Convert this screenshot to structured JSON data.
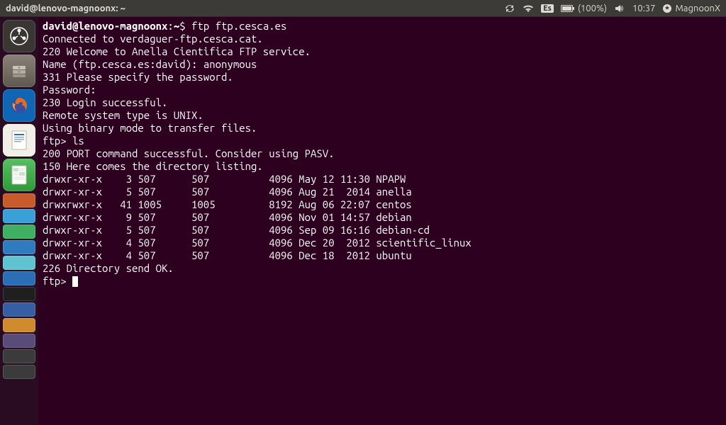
{
  "menubar": {
    "title": "david@lenovo-magnoonx: ~",
    "lang": "Es",
    "battery": "(100%)",
    "time": "10:37",
    "user": "MagnoonX"
  },
  "terminal": {
    "prompt_user": "david@lenovo-magnoonx",
    "prompt_path": "~",
    "cmd1": "ftp ftp.cesca.es",
    "l1": "Connected to verdaguer-ftp.cesca.cat.",
    "l2": "220 Welcome to Anella Cientifica FTP service.",
    "l3a": "Name (ftp.cesca.es:david): ",
    "l3b": "anonymous",
    "l4": "331 Please specify the password.",
    "l5": "Password:",
    "l6": "230 Login successful.",
    "l7": "Remote system type is UNIX.",
    "l8": "Using binary mode to transfer files.",
    "ftp_prompt": "ftp> ",
    "cmd2": "ls",
    "l9": "200 PORT command successful. Consider using PASV.",
    "l10": "150 Here comes the directory listing.",
    "rows": [
      "drwxr-xr-x    3 507      507          4096 May 12 11:30 NPAPW",
      "drwxr-xr-x    5 507      507          4096 Aug 21  2014 anella",
      "drwxrwxr-x   41 1005     1005         8192 Aug 06 22:07 centos",
      "drwxr-xr-x    9 507      507          4096 Nov 01 14:57 debian",
      "drwxr-xr-x    5 507      507          4096 Sep 09 16:16 debian-cd",
      "drwxr-xr-x    4 507      507          4096 Dec 20  2012 scientific_linux",
      "drwxr-xr-x    4 507      507          4096 Dec 18  2012 ubuntu"
    ],
    "l11": "226 Directory send OK."
  },
  "launcher": {
    "tiles": [
      {
        "name": "dash",
        "bg": "#3a3633"
      },
      {
        "name": "files",
        "bg": "#6f675f"
      },
      {
        "name": "firefox",
        "bg": "#1076c8"
      },
      {
        "name": "writer",
        "bg": "#f5f3f0"
      },
      {
        "name": "calc",
        "bg": "#44b04c"
      }
    ],
    "small": [
      "#c75b2a",
      "#3aa0d8",
      "#3fb061",
      "#2f7bc0",
      "#5fc3d1",
      "#2a6fb5",
      "#1f1f1f",
      "#365fa3",
      "#d08b2d",
      "#5a4c7a",
      "#3b3b3b",
      "#3b3b3b"
    ]
  }
}
